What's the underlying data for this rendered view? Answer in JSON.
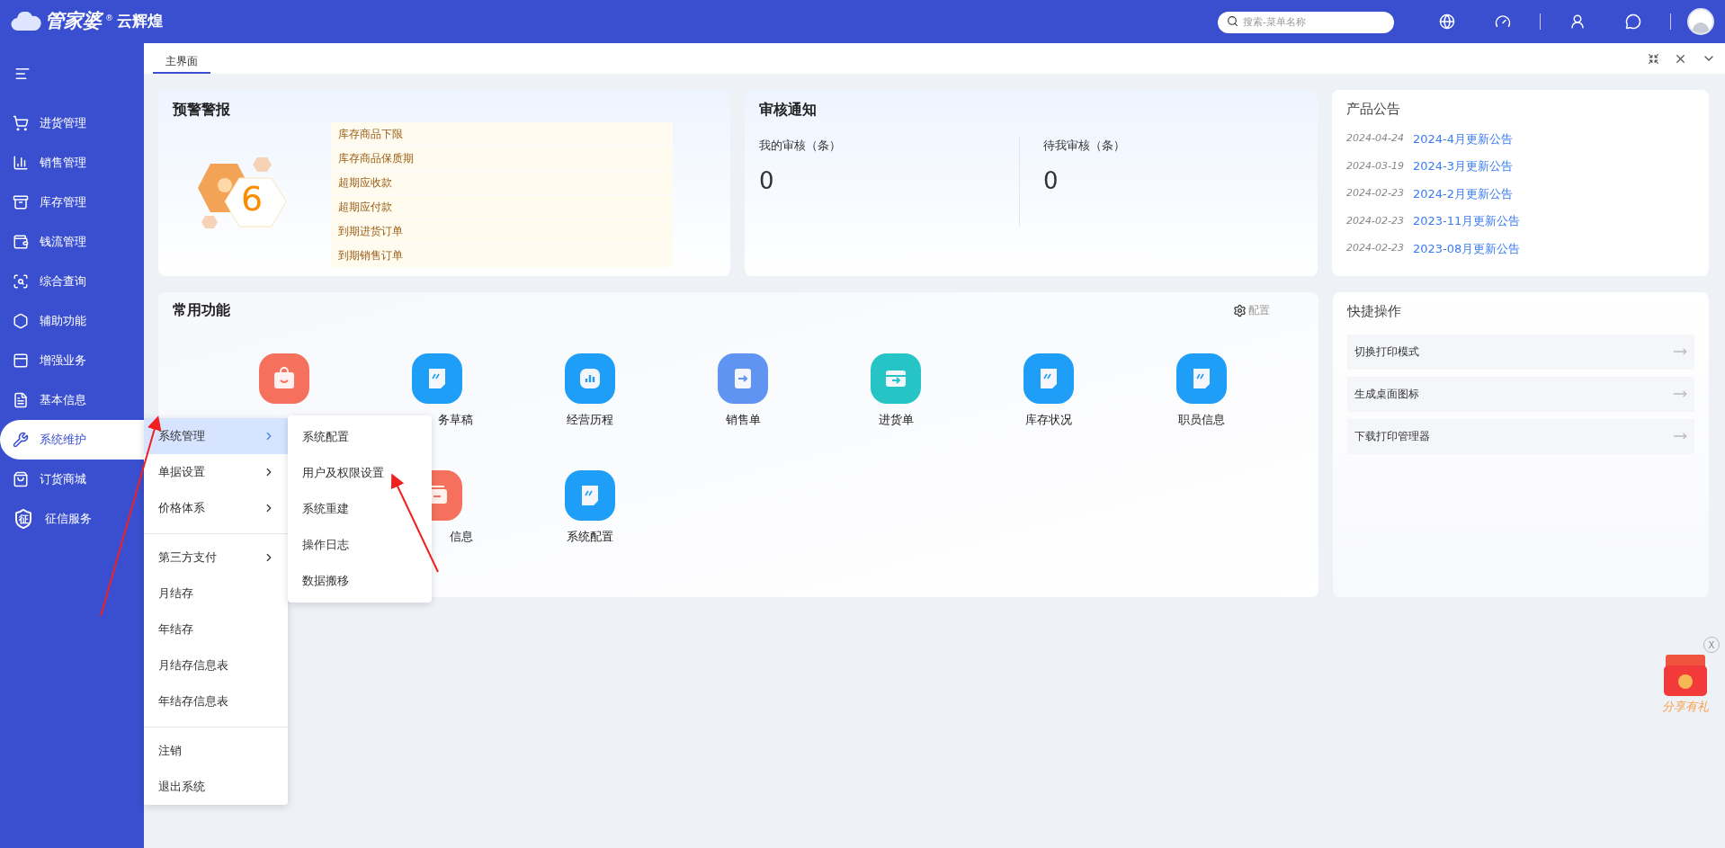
{
  "logo": {
    "brand": "管家婆",
    "mark": "®",
    "edition": "云辉煌"
  },
  "search": {
    "placeholder": "搜索-菜单名称"
  },
  "tabs": [
    {
      "label": "主界面",
      "selected": true
    }
  ],
  "sidebar": {
    "items": [
      {
        "label": "进货管理",
        "kind": "cart",
        "selected": false
      },
      {
        "label": "销售管理",
        "kind": "chart",
        "selected": false
      },
      {
        "label": "库存管理",
        "kind": "archive",
        "selected": false
      },
      {
        "label": "钱流管理",
        "kind": "wallet",
        "selected": false
      },
      {
        "label": "综合查询",
        "kind": "scan",
        "selected": false
      },
      {
        "label": "辅助功能",
        "kind": "hexagon",
        "selected": false
      },
      {
        "label": "增强业务",
        "kind": "panel",
        "selected": false
      },
      {
        "label": "基本信息",
        "kind": "file",
        "selected": false
      },
      {
        "label": "系统维护",
        "kind": "wrench",
        "selected": true
      },
      {
        "label": "订货商城",
        "kind": "bag",
        "selected": false
      },
      {
        "label": "征信服务",
        "kind": "shield",
        "badge": "征",
        "selected": false
      }
    ]
  },
  "alerts": {
    "title": "预警警报",
    "count": "6",
    "items": [
      "库存商品下限",
      "库存商品保质期",
      "超期应收款",
      "超期应付款",
      "到期进货订单",
      "到期销售订单"
    ]
  },
  "review": {
    "title": "审核通知",
    "columns": [
      {
        "label": "我的审核（条）",
        "value": "0"
      },
      {
        "label": "待我审核（条）",
        "value": "0"
      }
    ]
  },
  "announcements": {
    "title": "产品公告",
    "items": [
      {
        "date": "2024-04-24",
        "title": "2024-4月更新公告"
      },
      {
        "date": "2024-03-19",
        "title": "2024-3月更新公告"
      },
      {
        "date": "2024-02-23",
        "title": "2024-2月更新公告"
      },
      {
        "date": "2024-02-23",
        "title": "2023-11月更新公告"
      },
      {
        "date": "2024-02-23",
        "title": "2023-08月更新公告"
      }
    ]
  },
  "functions": {
    "title": "常用功能",
    "config": "配置",
    "items": [
      {
        "kind": "bag"
      },
      {
        "kind": "doc",
        "label": "务草稿",
        "partial": true
      },
      {
        "kind": "chart",
        "label": "经营历程"
      },
      {
        "kind": "arrow",
        "label": "销售单"
      },
      {
        "kind": "inbox",
        "label": "进货单"
      },
      {
        "kind": "doc",
        "label": "库存状况"
      },
      {
        "kind": "doc",
        "label": "职员信息"
      },
      {
        "kind": "covered"
      },
      {
        "kind": "cards",
        "label": "信息",
        "partial": true
      },
      {
        "kind": "doc",
        "label": "系统配置"
      }
    ]
  },
  "quick": {
    "title": "快捷操作",
    "items": [
      "切换打印模式",
      "生成桌面图标",
      "下载打印管理器"
    ]
  },
  "menu": {
    "groups": [
      [
        {
          "label": "系统管理",
          "submenu": true,
          "selected": true
        },
        {
          "label": "单据设置",
          "submenu": true,
          "selected": false
        },
        {
          "label": "价格体系",
          "submenu": true,
          "selected": false
        }
      ],
      [
        {
          "label": "第三方支付",
          "submenu": true,
          "selected": false
        },
        {
          "label": "月结存",
          "submenu": false,
          "selected": false
        },
        {
          "label": "年结存",
          "submenu": false,
          "selected": false
        },
        {
          "label": "月结存信息表",
          "submenu": false,
          "selected": false
        },
        {
          "label": "年结存信息表",
          "submenu": false,
          "selected": false
        }
      ],
      [
        {
          "label": "注销",
          "submenu": false,
          "selected": false
        },
        {
          "label": "退出系统",
          "submenu": false,
          "selected": false
        }
      ]
    ]
  },
  "submenu": {
    "items": [
      "系统配置",
      "用户及权限设置",
      "系统重建",
      "操作日志",
      "数据搬移"
    ]
  },
  "promo": {
    "close": "X",
    "label": "分享有礼"
  }
}
